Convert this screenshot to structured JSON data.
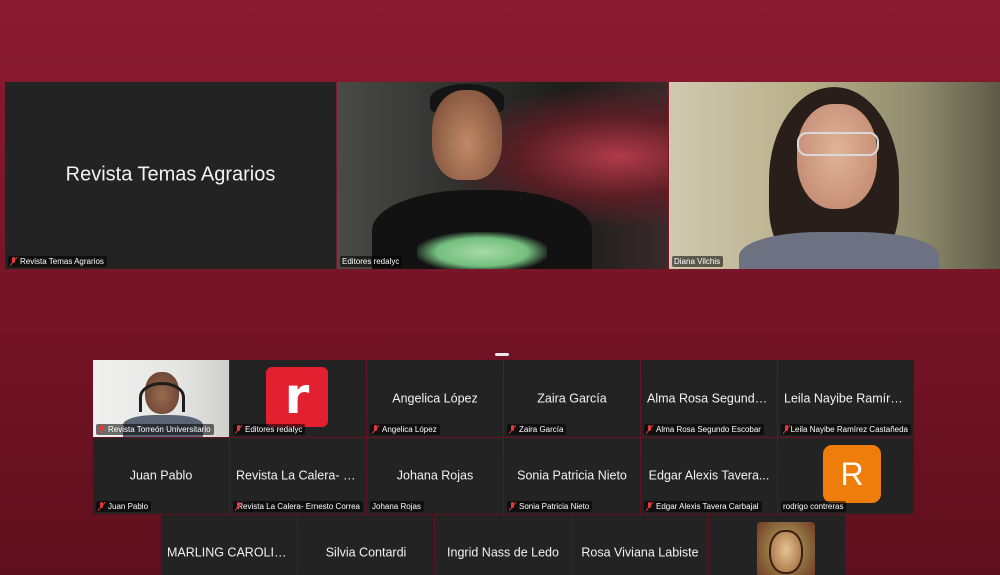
{
  "speaker_strip": [
    {
      "name": "Revista Temas Agrarios",
      "label": "Revista Temas Agrarios",
      "muted": true,
      "type": "name"
    },
    {
      "name": "",
      "label": "Editores redalyc",
      "muted": false,
      "type": "video-man"
    },
    {
      "name": "",
      "label": "Diana Vilchis",
      "muted": false,
      "type": "video-woman",
      "active": true
    }
  ],
  "grid": {
    "row1": [
      {
        "name": "",
        "label": "Revista Torreón Universitario",
        "muted": true,
        "type": "video-small-man"
      },
      {
        "name": "",
        "label": "Editores redalyc",
        "muted": true,
        "type": "logo",
        "logo_letter": "r"
      },
      {
        "name": "Angelica López",
        "label": "Angelica López",
        "muted": true,
        "type": "name"
      },
      {
        "name": "Zaira García",
        "label": "Zaira García",
        "muted": true,
        "type": "name"
      },
      {
        "name": "Alma Rosa Segundo...",
        "label": "Alma Rosa Segundo Escobar",
        "muted": true,
        "type": "name"
      },
      {
        "name": "Leila Nayibe Ramírez...",
        "label": "Leila Nayibe Ramírez Castañeda",
        "muted": true,
        "type": "name"
      }
    ],
    "row2": [
      {
        "name": "Juan Pablo",
        "label": "Juan Pablo",
        "muted": true,
        "type": "name"
      },
      {
        "name": "Revista La Calera- Er...",
        "label": "Revista La Calera- Ernesto Correa",
        "muted": true,
        "type": "name"
      },
      {
        "name": "Johana Rojas",
        "label": "Johana Rojas",
        "muted": false,
        "type": "name"
      },
      {
        "name": "Sonia Patricia Nieto",
        "label": "Sonia Patricia Nieto",
        "muted": true,
        "type": "name"
      },
      {
        "name": "Edgar Alexis Tavera...",
        "label": "Edgar Alexis Tavera Carbajal",
        "muted": true,
        "type": "name"
      },
      {
        "name": "",
        "label": "rodrigo contreras",
        "muted": false,
        "type": "avatar",
        "avatar_letter": "R"
      }
    ],
    "row3": [
      {
        "name": "MARLING CAROLIN...",
        "type": "name"
      },
      {
        "name": "Silvia Contardi",
        "type": "name"
      },
      {
        "name": "Ingrid Nass de Ledo",
        "type": "name"
      },
      {
        "name": "Rosa Viviana Labiste",
        "type": "name"
      },
      {
        "name": "",
        "type": "portrait"
      }
    ]
  },
  "colors": {
    "background": "#7a1528",
    "tile": "#232323",
    "active_speaker": "#3fcf4c",
    "muted_icon": "#e0393e",
    "redalyc_logo": "#e3202f",
    "avatar_orange": "#ef7d0b"
  }
}
